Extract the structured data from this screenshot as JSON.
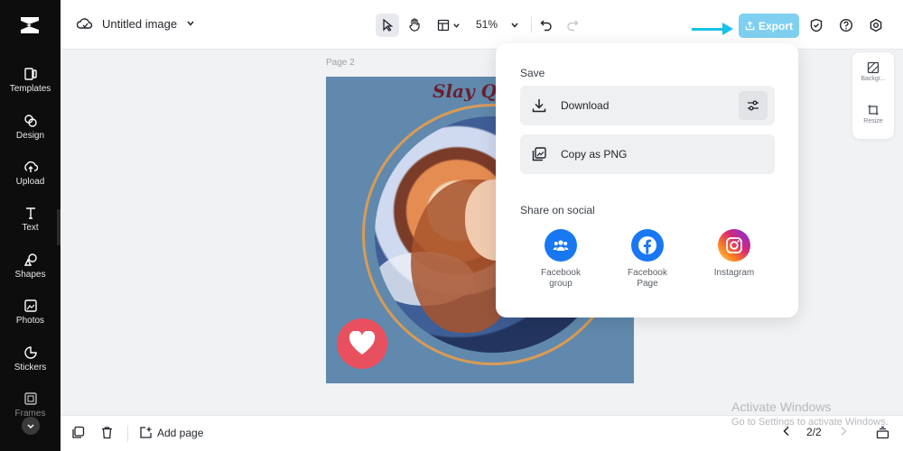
{
  "sidebar": {
    "items": [
      {
        "label": "Templates",
        "icon": "templates-icon"
      },
      {
        "label": "Design",
        "icon": "design-icon"
      },
      {
        "label": "Upload",
        "icon": "upload-icon"
      },
      {
        "label": "Text",
        "icon": "text-icon"
      },
      {
        "label": "Shapes",
        "icon": "shapes-icon"
      },
      {
        "label": "Photos",
        "icon": "photos-icon"
      },
      {
        "label": "Stickers",
        "icon": "stickers-icon"
      },
      {
        "label": "Frames",
        "icon": "frames-icon"
      }
    ]
  },
  "topbar": {
    "title": "Untitled image",
    "zoom": "51%",
    "export_label": "Export"
  },
  "canvas": {
    "page_label": "Page 2",
    "design_text": "Slay Q"
  },
  "right_panel": {
    "background_label": "Backgr...",
    "resize_label": "Resize"
  },
  "export_panel": {
    "save_heading": "Save",
    "download_label": "Download",
    "copy_label": "Copy as PNG",
    "share_heading": "Share on social",
    "social": [
      {
        "line1": "Facebook",
        "line2": "group",
        "color": "#1877f2"
      },
      {
        "line1": "Facebook",
        "line2": "Page",
        "color": "#1877f2"
      },
      {
        "line1": "Instagram",
        "line2": "",
        "color": "#d62976"
      }
    ]
  },
  "bottombar": {
    "add_page_label": "Add page",
    "page_counter": "2/2"
  },
  "watermark": {
    "line1": "Activate Windows",
    "line2": "Go to Settings to activate Windows."
  }
}
